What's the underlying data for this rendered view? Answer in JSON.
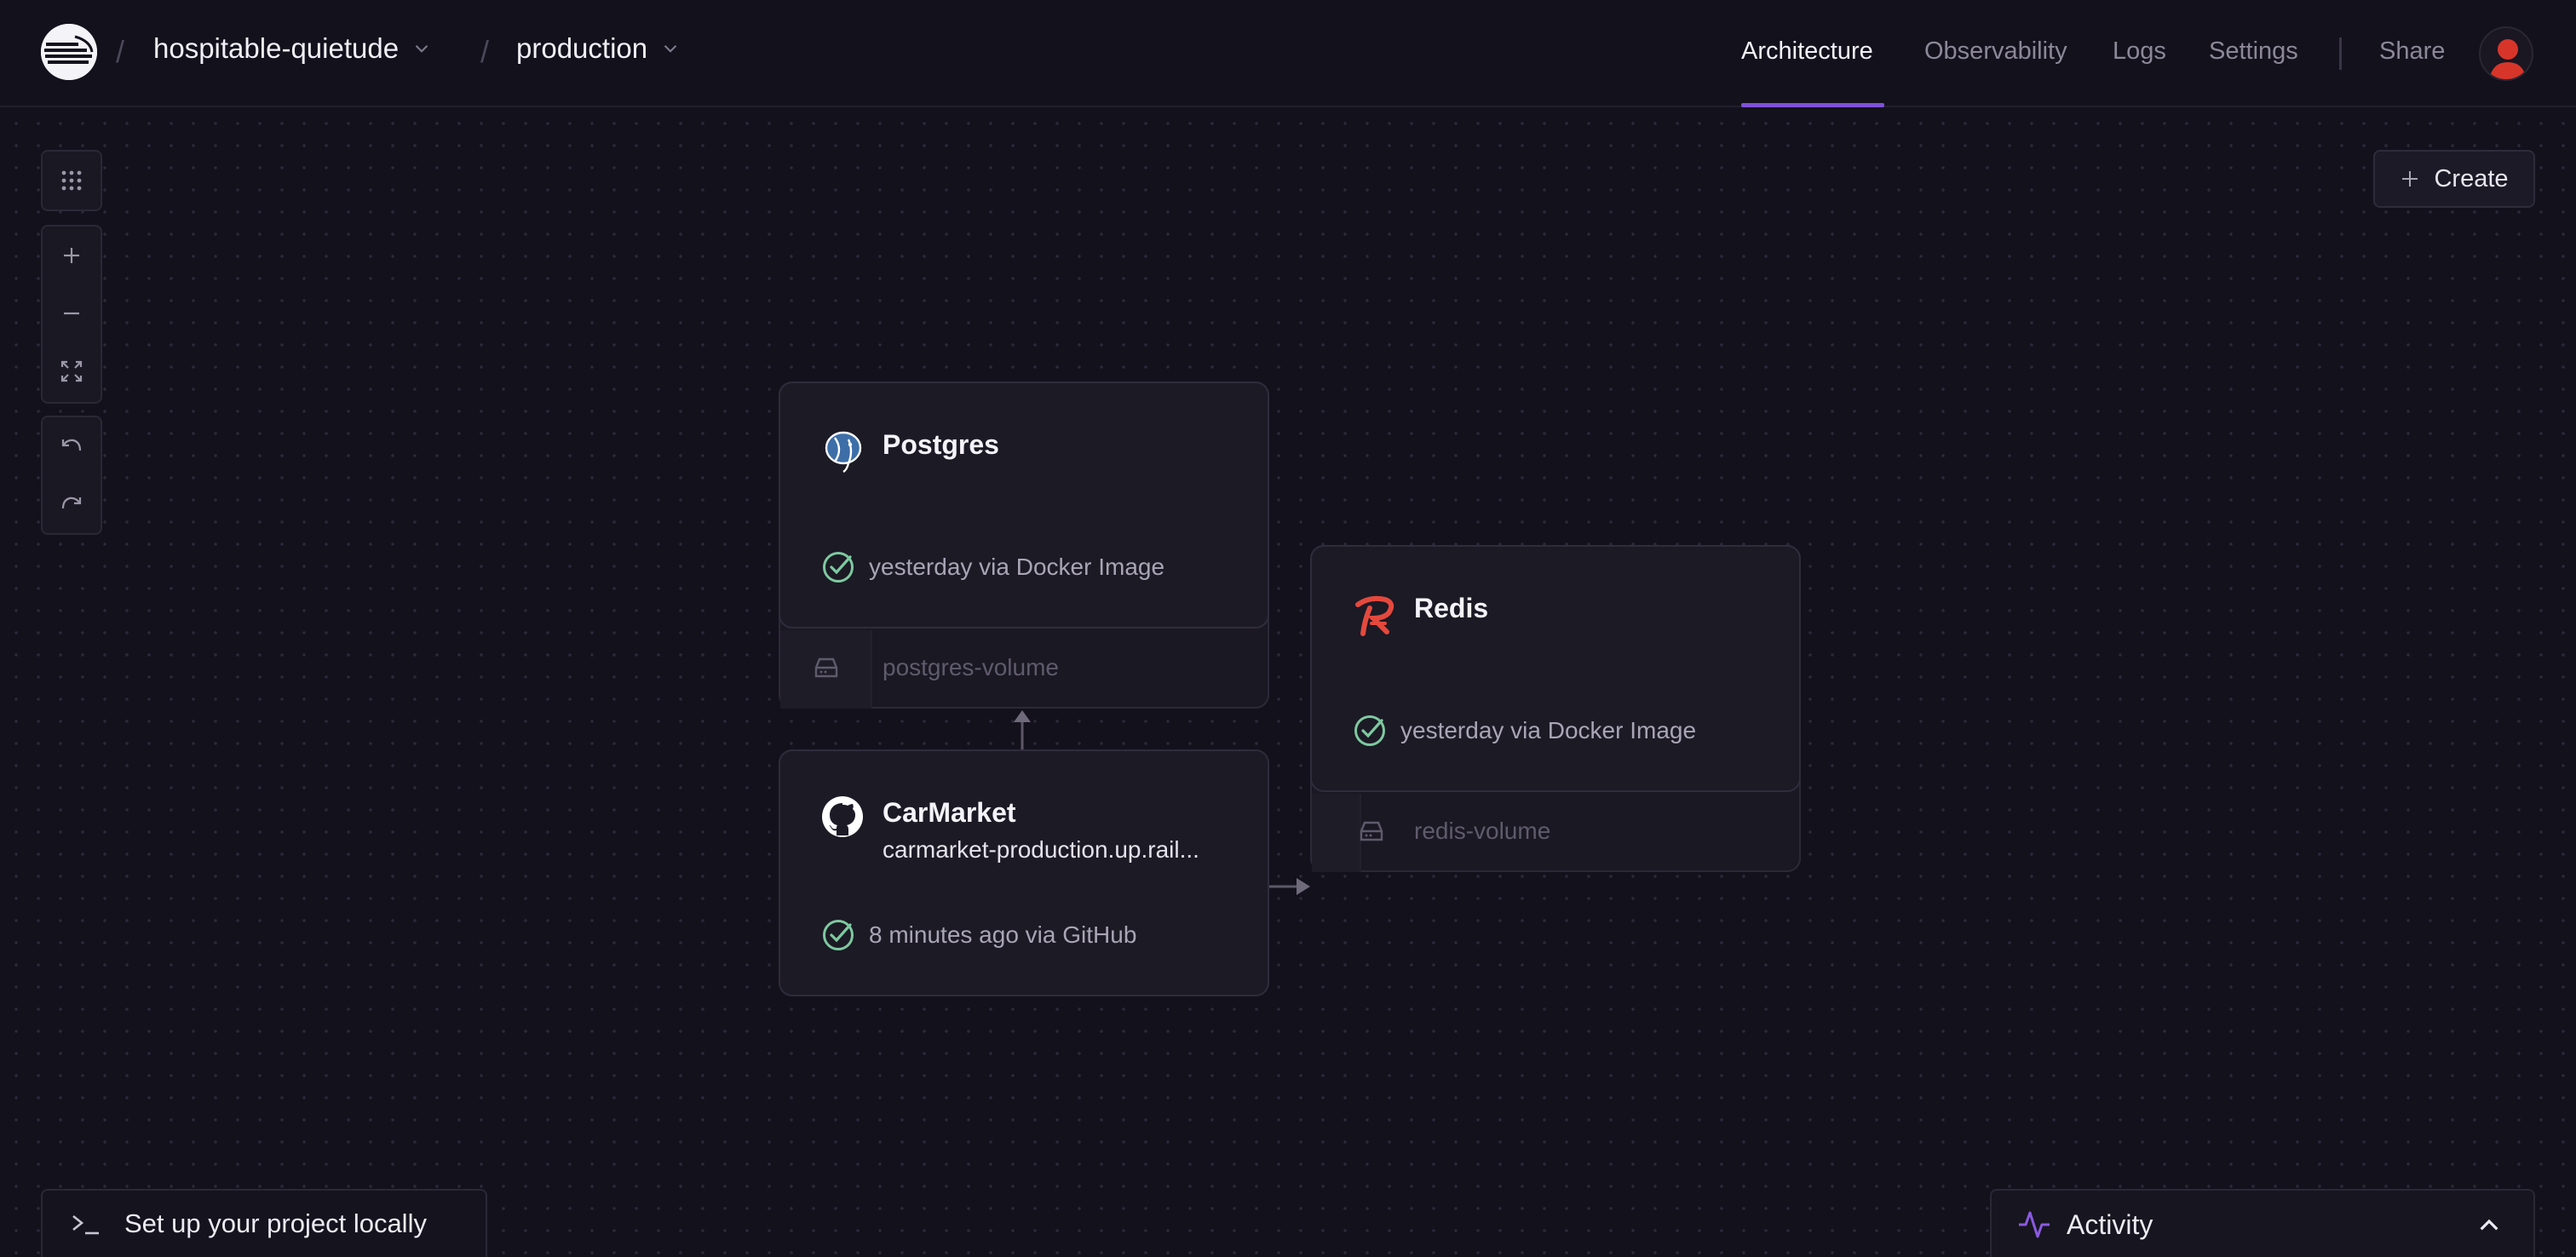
{
  "header": {
    "project": "hospitable-quietude",
    "environment": "production",
    "separator": "/",
    "tabs": [
      "Architecture",
      "Observability",
      "Logs",
      "Settings"
    ],
    "active_tab": "Architecture",
    "share": "Share"
  },
  "canvas": {
    "create_label": "Create",
    "tools": [
      "grid-icon",
      "zoom-in-icon",
      "zoom-out-icon",
      "fit-view-icon",
      "undo-icon",
      "redo-icon"
    ]
  },
  "services": {
    "postgres": {
      "name": "Postgres",
      "status": "yesterday via Docker Image",
      "volume": "postgres-volume",
      "icon": "postgres-icon"
    },
    "redis": {
      "name": "Redis",
      "status": "yesterday via Docker Image",
      "volume": "redis-volume",
      "icon": "redis-icon"
    },
    "carmarket": {
      "name": "CarMarket",
      "domain": "carmarket-production.up.rail...",
      "status": "8 minutes ago via GitHub",
      "icon": "github-icon"
    }
  },
  "footer": {
    "setup_label": "Set up your project locally",
    "activity_label": "Activity"
  },
  "colors": {
    "background": "#13111c",
    "accent": "#7f51d8",
    "success": "#7ec9a0",
    "redis": "#e5493d"
  }
}
